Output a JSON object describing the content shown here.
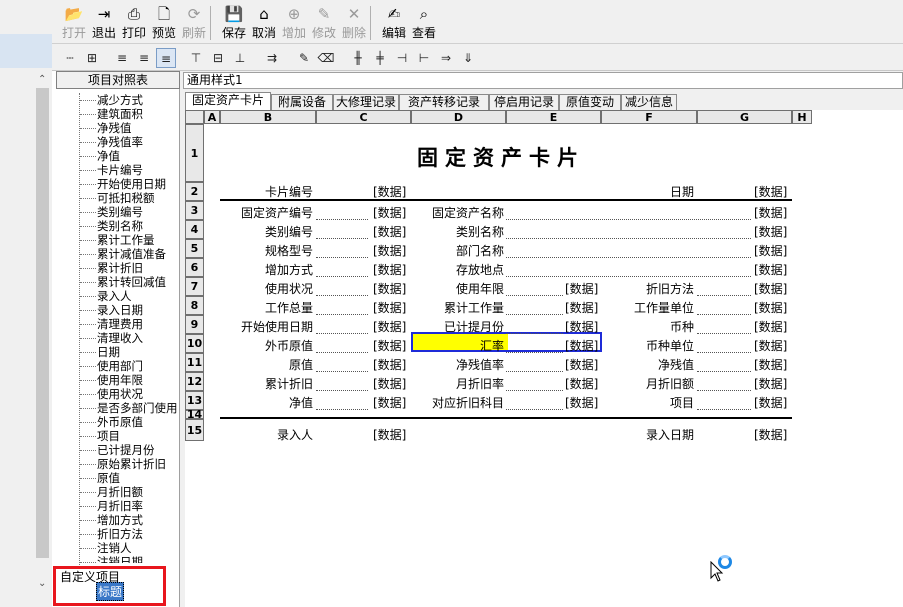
{
  "toolbar": {
    "buttons": [
      {
        "label": "打开",
        "icon": "folder-open-icon",
        "enabled": false
      },
      {
        "label": "退出",
        "icon": "exit-door-icon",
        "enabled": true
      },
      {
        "label": "打印",
        "icon": "printer-icon",
        "enabled": true
      },
      {
        "label": "预览",
        "icon": "print-preview-icon",
        "enabled": true
      },
      {
        "label": "刷新",
        "icon": "refresh-icon",
        "enabled": false
      },
      {
        "label": "保存",
        "icon": "save-disk-icon",
        "enabled": true
      },
      {
        "label": "取消",
        "icon": "cancel-bucket-icon",
        "enabled": true
      },
      {
        "label": "增加",
        "icon": "add-icon",
        "enabled": false
      },
      {
        "label": "修改",
        "icon": "edit-pencil-icon",
        "enabled": false
      },
      {
        "label": "删除",
        "icon": "delete-x-icon",
        "enabled": false
      },
      {
        "label": "编辑",
        "icon": "edit-document-icon",
        "enabled": true
      },
      {
        "label": "查看",
        "icon": "view-icon",
        "enabled": true
      }
    ]
  },
  "tree": {
    "header": "项目对照表",
    "items": [
      "减少方式",
      "建筑面积",
      "净残值",
      "净残值率",
      "净值",
      "卡片编号",
      "开始使用日期",
      "可抵扣税额",
      "类别编号",
      "类别名称",
      "累计工作量",
      "累计减值准备",
      "累计折旧",
      "累计转回减值",
      "录入人",
      "录入日期",
      "清理费用",
      "清理收入",
      "日期",
      "使用部门",
      "使用年限",
      "使用状况",
      "是否多部门使用",
      "外币原值",
      "项目",
      "已计提月份",
      "原始累计折旧",
      "原值",
      "月折旧额",
      "月折旧率",
      "增加方式",
      "折旧方法",
      "注销人",
      "注销日期"
    ],
    "custom_group": "自定义项目",
    "custom_title": "标题"
  },
  "style_name": "通用样式1",
  "tabs": [
    "固定资产卡片",
    "附属设备",
    "大修理记录",
    "资产转移记录",
    "停启用记录",
    "原值变动",
    "减少信息"
  ],
  "sheet": {
    "columns": [
      "A",
      "B",
      "C",
      "D",
      "E",
      "F",
      "G",
      "H"
    ],
    "rows": [
      "1",
      "2",
      "3",
      "4",
      "5",
      "6",
      "7",
      "8",
      "9",
      "10",
      "11",
      "12",
      "13",
      "14",
      "15"
    ],
    "title": "固定资产卡片",
    "placeholder": "[数据]",
    "row2": {
      "label": "卡片编号",
      "date_label": "日期"
    },
    "fields": [
      {
        "b": "固定资产编号",
        "d": "固定资产名称",
        "f": ""
      },
      {
        "b": "类别编号",
        "d": "类别名称",
        "f": ""
      },
      {
        "b": "规格型号",
        "d": "部门名称",
        "f": ""
      },
      {
        "b": "增加方式",
        "d": "存放地点",
        "f": ""
      },
      {
        "b": "使用状况",
        "d": "使用年限",
        "f": "折旧方法"
      },
      {
        "b": "工作总量",
        "d": "累计工作量",
        "f": "工作量单位"
      },
      {
        "b": "开始使用日期",
        "d": "已计提月份",
        "f": "币种"
      },
      {
        "b": "外币原值",
        "d": "汇率",
        "f": "币种单位"
      },
      {
        "b": "原值",
        "d": "净残值率",
        "f": "净残值"
      },
      {
        "b": "累计折旧",
        "d": "月折旧率",
        "f": "月折旧额"
      },
      {
        "b": "净值",
        "d": "对应折旧科目",
        "f": "项目"
      }
    ],
    "row15": {
      "label": "录入人",
      "date_label": "录入日期"
    }
  }
}
